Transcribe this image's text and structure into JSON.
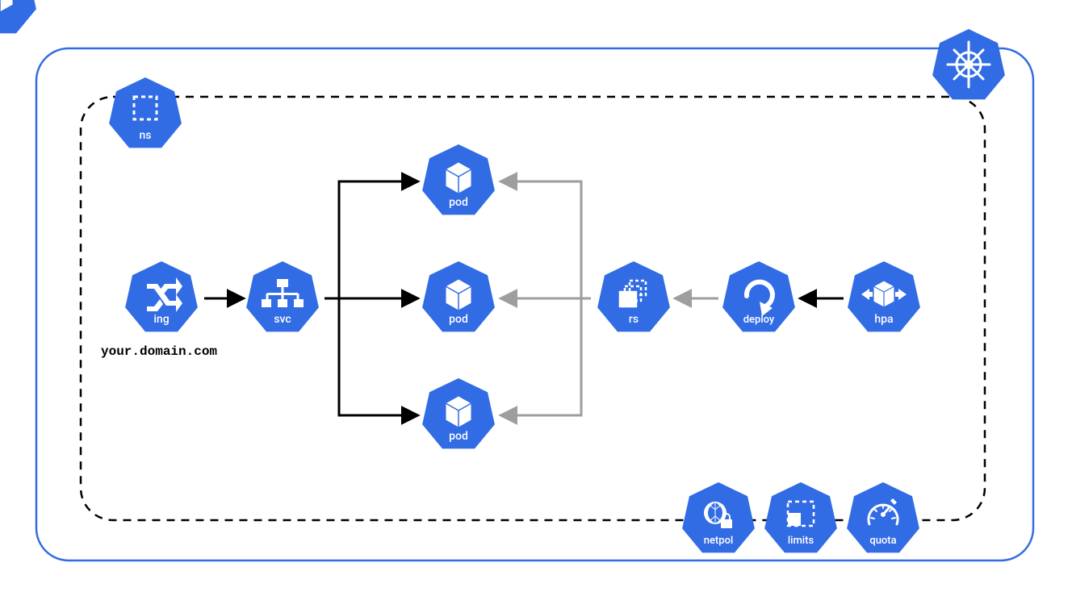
{
  "diagram": {
    "outerBoxColor": "#326CE5",
    "innerBoxColor": "#000000",
    "domain": "your.domain.com"
  },
  "nodes": {
    "k8sLogo": {
      "label": ""
    },
    "ns": {
      "label": "ns"
    },
    "ing": {
      "label": "ing"
    },
    "svc": {
      "label": "svc"
    },
    "pod1": {
      "label": "pod"
    },
    "pod2": {
      "label": "pod"
    },
    "pod3": {
      "label": "pod"
    },
    "rs": {
      "label": "rs"
    },
    "deploy": {
      "label": "deploy"
    },
    "hpa": {
      "label": "hpa"
    },
    "netpol": {
      "label": "netpol"
    },
    "limits": {
      "label": "limits"
    },
    "quota": {
      "label": "quota"
    }
  },
  "colors": {
    "k8sBlue": "#326CE5",
    "arrowBlack": "#000000",
    "arrowGray": "#9E9E9E"
  }
}
